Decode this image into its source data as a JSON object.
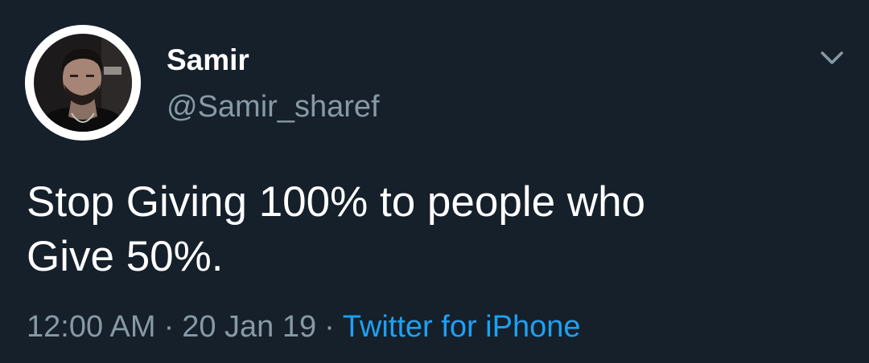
{
  "tweet": {
    "author": {
      "display_name": "Samir",
      "handle": "@Samir_sharef",
      "avatar": "profile-photo"
    },
    "text_lines": [
      "Stop Giving 100% to people who",
      "Give 50%."
    ],
    "time": "12:00 AM",
    "separator": "·",
    "date": "20 Jan 19",
    "source": "Twitter for iPhone",
    "menu_icon": "chevron-down-icon"
  },
  "colors": {
    "background": "#15202b",
    "text": "#ffffff",
    "secondary": "#8899a6",
    "link": "#1da1f2"
  }
}
